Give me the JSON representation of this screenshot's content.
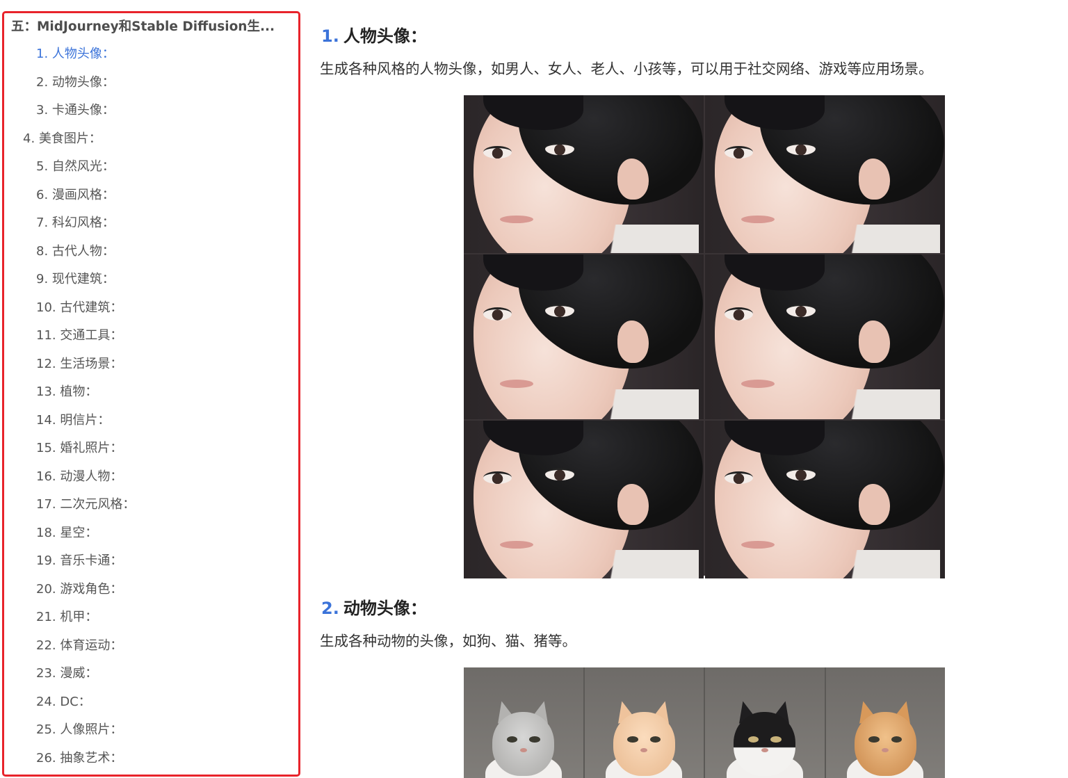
{
  "toc": {
    "title": "五：MidJourney和Stable Diffusion生...",
    "items": [
      {
        "label": "1. 人物头像：",
        "level": "sub",
        "active": true
      },
      {
        "label": "2. 动物头像：",
        "level": "sub"
      },
      {
        "label": "3. 卡通头像：",
        "level": "sub"
      },
      {
        "label": "4. 美食图片：",
        "level": "main"
      },
      {
        "label": "5. 自然风光：",
        "level": "sub"
      },
      {
        "label": "6. 漫画风格：",
        "level": "sub"
      },
      {
        "label": "7. 科幻风格：",
        "level": "sub"
      },
      {
        "label": "8. 古代人物：",
        "level": "sub"
      },
      {
        "label": "9. 现代建筑：",
        "level": "sub"
      },
      {
        "label": "10. 古代建筑：",
        "level": "sub"
      },
      {
        "label": "11. 交通工具：",
        "level": "sub"
      },
      {
        "label": "12. 生活场景：",
        "level": "sub"
      },
      {
        "label": "13. 植物：",
        "level": "sub"
      },
      {
        "label": "14. 明信片：",
        "level": "sub"
      },
      {
        "label": "15. 婚礼照片：",
        "level": "sub"
      },
      {
        "label": "16. 动漫人物：",
        "level": "sub"
      },
      {
        "label": "17. 二次元风格：",
        "level": "sub"
      },
      {
        "label": "18. 星空：",
        "level": "sub"
      },
      {
        "label": "19. 音乐卡通：",
        "level": "sub"
      },
      {
        "label": "20. 游戏角色：",
        "level": "sub"
      },
      {
        "label": "21. 机甲：",
        "level": "sub"
      },
      {
        "label": "22. 体育运动：",
        "level": "sub"
      },
      {
        "label": "23. 漫威：",
        "level": "sub"
      },
      {
        "label": "24. DC：",
        "level": "sub"
      },
      {
        "label": "25. 人像照片：",
        "level": "sub"
      },
      {
        "label": "26. 抽象艺术：",
        "level": "sub"
      }
    ]
  },
  "article": {
    "section1": {
      "num": "1.",
      "heading": "人物头像：",
      "text": "生成各种风格的人物头像，如男人、女人、老人、小孩等，可以用于社交网络、游戏等应用场景。"
    },
    "section2": {
      "num": "2.",
      "heading": "动物头像：",
      "text": "生成各种动物的头像，如狗、猫、猪等。"
    }
  },
  "colors": {
    "highlight_border": "#e8232b",
    "accent": "#3b73d9",
    "toc_text": "#555555"
  }
}
